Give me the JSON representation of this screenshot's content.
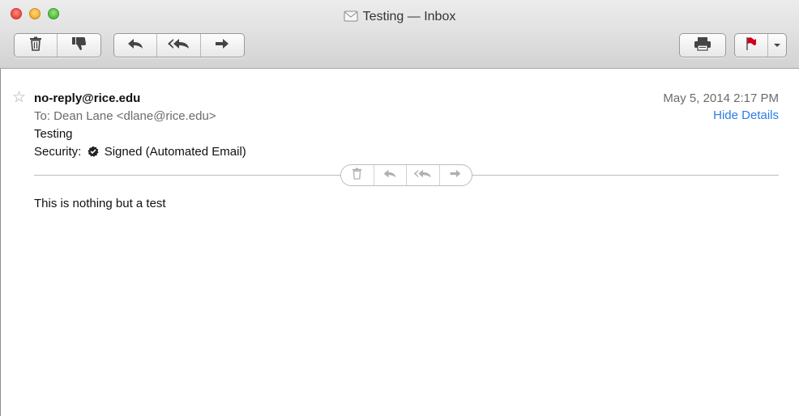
{
  "window": {
    "title": "Testing — Inbox"
  },
  "toolbar": {
    "delete_icon": "trash-icon",
    "junk_icon": "thumbs-down-icon",
    "reply_icon": "reply-arrow-icon",
    "reply_all_icon": "reply-all-arrow-icon",
    "forward_icon": "forward-arrow-icon",
    "print_icon": "printer-icon",
    "flag_icon": "flag-icon",
    "flag_color": "#d0021b"
  },
  "message": {
    "from": "no-reply@rice.edu",
    "date": "May 5, 2014  2:17 PM",
    "hide_details": "Hide Details",
    "to": "To:  Dean Lane <dlane@rice.edu>",
    "subject": "Testing",
    "security_label": "Security:",
    "security_value": "Signed (Automated Email)",
    "body": "This is nothing but a test"
  },
  "colors": {
    "link": "#2c7be5",
    "close": "#f2534a",
    "minimize": "#f6b73c",
    "zoom": "#5fc647"
  }
}
